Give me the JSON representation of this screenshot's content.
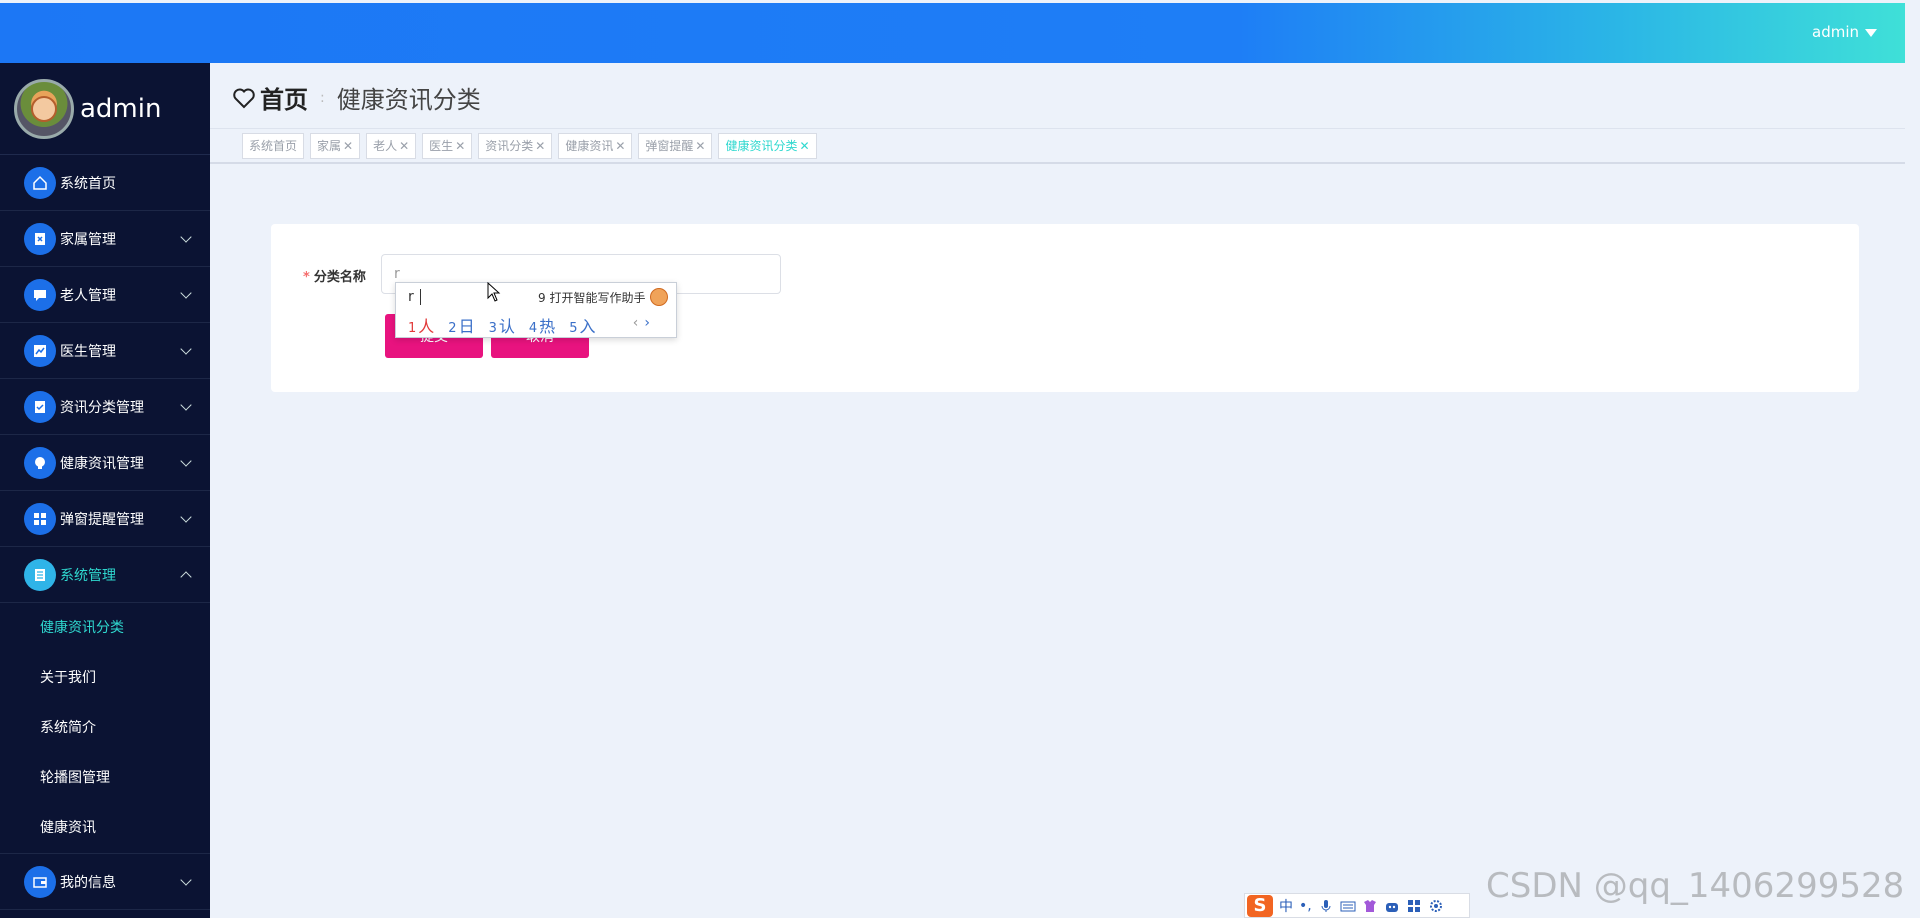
{
  "header": {
    "user": "admin"
  },
  "sidebar": {
    "username": "admin",
    "menu": [
      {
        "label": "系统首页",
        "icon": "home-icon",
        "expandable": false
      },
      {
        "label": "家属管理",
        "icon": "clipboard-x-icon",
        "expandable": true
      },
      {
        "label": "老人管理",
        "icon": "chat-icon",
        "expandable": true
      },
      {
        "label": "医生管理",
        "icon": "chart-icon",
        "expandable": true
      },
      {
        "label": "资讯分类管理",
        "icon": "clipboard-check-icon",
        "expandable": true
      },
      {
        "label": "健康资讯管理",
        "icon": "bulb-icon",
        "expandable": true
      },
      {
        "label": "弹窗提醒管理",
        "icon": "grid-icon",
        "expandable": true
      },
      {
        "label": "系统管理",
        "icon": "notebook-icon",
        "expandable": true,
        "expanded": true
      }
    ],
    "system_sub": [
      "健康资讯分类",
      "关于我们",
      "系统简介",
      "轮播图管理",
      "健康资讯"
    ],
    "my_info": {
      "label": "我的信息",
      "icon": "wallet-icon"
    }
  },
  "breadcrumb": {
    "home": "首页",
    "separator": ":",
    "current": "健康资讯分类"
  },
  "tags": [
    {
      "label": "系统首页",
      "closable": false
    },
    {
      "label": "家属",
      "closable": true
    },
    {
      "label": "老人",
      "closable": true
    },
    {
      "label": "医生",
      "closable": true
    },
    {
      "label": "资讯分类",
      "closable": true
    },
    {
      "label": "健康资讯",
      "closable": true
    },
    {
      "label": "弹窗提醒",
      "closable": true
    },
    {
      "label": "健康资讯分类",
      "closable": true,
      "active": true
    }
  ],
  "form": {
    "label": "分类名称",
    "input_value": "r",
    "submit_label": "提交",
    "cancel_label": "取消"
  },
  "ime": {
    "composition": "r",
    "assist_label": "9 打开智能写作助手",
    "candidates": [
      {
        "num": "1",
        "text": "人"
      },
      {
        "num": "2",
        "text": "日"
      },
      {
        "num": "3",
        "text": "认"
      },
      {
        "num": "4",
        "text": "热"
      },
      {
        "num": "5",
        "text": "入"
      }
    ],
    "prev": "‹",
    "next": "›"
  },
  "ime_toolbar": {
    "logo": "S",
    "mode": "中",
    "punct": "•,"
  },
  "watermark": "CSDN @qq_1406299528",
  "colors": {
    "accent": "#2fd8cf",
    "button": "#e8137f",
    "sidebar": "#0b1333",
    "header_start": "#1c77f5",
    "header_end": "#3fe0d8"
  }
}
